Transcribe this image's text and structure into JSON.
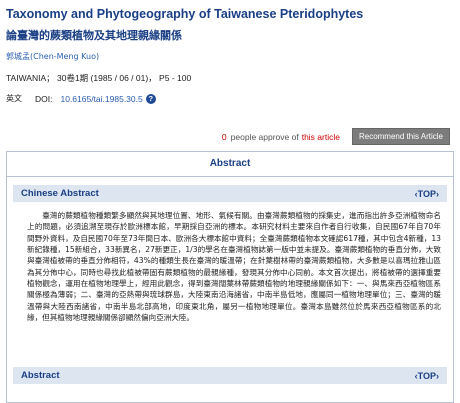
{
  "article": {
    "title_en": "Taxonomy and Phytogeography of Taiwanese Pteridophytes",
    "title_zh": "論臺灣的蕨類植物及其地理親緣關係",
    "author": "郭城孟(Chen-Meng Kuo)",
    "citation": "TAIWANIA； 30卷1期 (1985 / 06 / 01)， P5 - 100",
    "language_label": "英文",
    "doi_label": "DOI:",
    "doi": "10.6165/tai.1985.30.5",
    "help_icon_glyph": "?"
  },
  "approval": {
    "count": "0",
    "text": "people approve of",
    "link": "this article",
    "recommend_button": "Recommend this Article"
  },
  "abstract": {
    "header": "Abstract",
    "zh_section_label": "Chinese Abstract",
    "top_link": "‹TOP›",
    "zh_text": "臺灣的蕨類植物種類繁多顯然與其地理位置、地形、氣候有關。由臺灣蕨類植物的採集史，進而指出許多亞洲植物命名上的問題，必須追溯至現存於歐洲標本館，早期採自亞洲的標本。本研究材料主要來自作者自行收集，自民國67年自70年間野外資料，及自民國70年至73年間日本、歐洲各大標本館中資料；全臺灣蕨類植物本文確認617種，其中包含4新種，13新紀錄種，15新組合，33新異名，27新更正，1/3的學名在臺灣植物誌第一版中並未提及。臺灣蕨類植物的垂直分佈，大致與臺灣植被帶的垂直分佈相符，43%的種類生長在臺灣的暖溫帶；在針葉樹林帶的臺灣蕨類植物，大多數是以喜瑪拉雅山區為其分佈中心，同時也尋找此植被帶固有蕨類植物的最親緣種，發現其分佈中心同前。本文首次提出，將植被帶的選擇重要植物觀念，運用在植物地理學上，經用此觀念，得到臺灣闊葉林帶蕨類植物的地理親緣關係如下：一、與馬來西亞植物區系關係極為薄弱；二、臺灣的亞熱帶與琉球群島，大陸東南沿海諸省，中南半島低地，應屬同一植物地理單位；三、臺灣的暖溫帶與大陸西南諸省，中南半島北部高地，印度東北角，屬另一植物地理單位。臺灣本島雖然位於馬來西亞植物區系的北緣，但其植物地理親緣關係卻顯然偏向亞洲大陸。",
    "en_section_label": "Abstract"
  }
}
